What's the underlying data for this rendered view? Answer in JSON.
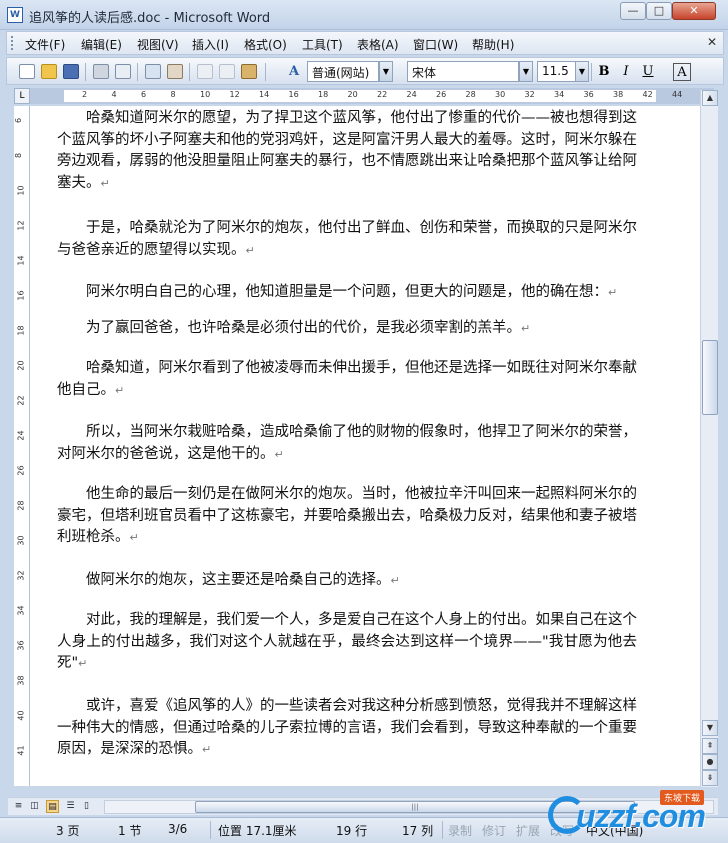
{
  "window": {
    "title": "追风筝的人读后感.doc - Microsoft Word",
    "app_icon": "W",
    "buttons": {
      "minimize": "—",
      "maximize": "□",
      "close": "✕"
    }
  },
  "menu": {
    "items": [
      "文件(F)",
      "编辑(E)",
      "视图(V)",
      "插入(I)",
      "格式(O)",
      "工具(T)",
      "表格(A)",
      "窗口(W)",
      "帮助(H)"
    ],
    "doc_close": "✕"
  },
  "toolbar": {
    "style": "普通(网站)",
    "font": "宋体",
    "size": "11.5",
    "bold": "B",
    "italic": "I",
    "underline": "U",
    "font_color": "A",
    "style_marker": "A"
  },
  "ruler": {
    "h_ticks": [
      "2",
      "4",
      "6",
      "8",
      "10",
      "12",
      "14",
      "16",
      "18",
      "20",
      "22",
      "24",
      "26",
      "28",
      "30",
      "32",
      "34",
      "36",
      "38",
      "42",
      "44"
    ],
    "v_ticks": [
      "6",
      "8",
      "10",
      "12",
      "14",
      "16",
      "18",
      "20",
      "22",
      "24",
      "26",
      "28",
      "30",
      "32",
      "34",
      "36",
      "38",
      "40",
      "41"
    ]
  },
  "document": {
    "paragraphs": [
      "哈桑知道阿米尔的愿望，为了捍卫这个蓝风筝，他付出了惨重的代价——被也想得到这个蓝风筝的坏小子阿塞夫和他的党羽鸡奸，这是阿富汗男人最大的羞辱。这时，阿米尔躲在旁边观看，孱弱的他没胆量阻止阿塞夫的暴行，也不情愿跳出来让哈桑把那个蓝风筝让给阿塞夫。",
      "于是，哈桑就沦为了阿米尔的炮灰，他付出了鲜血、创伤和荣誉，而换取的只是阿米尔与爸爸亲近的愿望得以实现。",
      "阿米尔明白自己的心理，他知道胆量是一个问题，但更大的问题是，他的确在想：",
      "为了赢回爸爸，也许哈桑是必须付出的代价，是我必须宰割的羔羊。",
      "哈桑知道，阿米尔看到了他被凌辱而未伸出援手，但他还是选择一如既往对阿米尔奉献他自己。",
      "所以，当阿米尔栽赃哈桑，造成哈桑偷了他的财物的假象时，他捍卫了阿米尔的荣誉，对阿米尔的爸爸说，这是他干的。",
      "他生命的最后一刻仍是在做阿米尔的炮灰。当时，他被拉辛汗叫回来一起照料阿米尔的豪宅，但塔利班官员看中了这栋豪宅，并要哈桑搬出去，哈桑极力反对，结果他和妻子被塔利班枪杀。",
      "做阿米尔的炮灰，这主要还是哈桑自己的选择。",
      "对此，我的理解是，我们爱一个人，多是爱自己在这个人身上的付出。如果自己在这个人身上的付出越多，我们对这个人就越在乎，最终会达到这样一个境界——\"我甘愿为他去死\"",
      "或许，喜爱《追风筝的人》的一些读者会对我这种分析感到愤怒，觉得我并不理解这样一种伟大的情感，但通过哈桑的儿子索拉博的言语，我们会看到，导致这种奉献的一个重要原因，是深深的恐惧。"
    ],
    "cursor_paragraph": 6,
    "para_mark": "↵"
  },
  "status": {
    "page": "3 页",
    "section": "1 节",
    "pages": "3/6",
    "position": "位置 17.1厘米",
    "line": "19 行",
    "column": "17 列",
    "rec": "录制",
    "trk": "修订",
    "ext": "扩展",
    "ovr": "改写",
    "language": "中文(中国)"
  },
  "watermark": {
    "text": "uzzf.com",
    "badge": "东坡下载"
  },
  "colors": {
    "accent": "#2b5ea8",
    "watermark": "#1f8ee0",
    "badge": "#e35a1f"
  }
}
